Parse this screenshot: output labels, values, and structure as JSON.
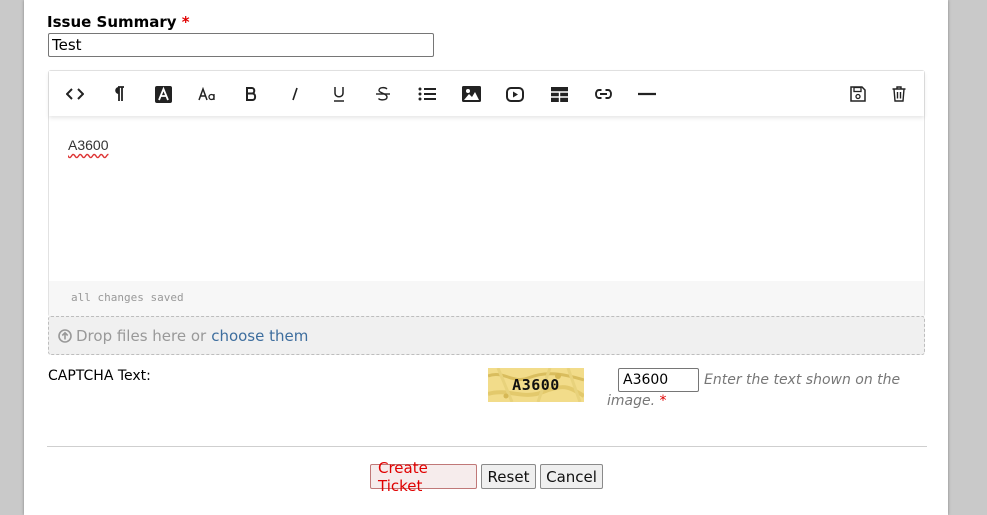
{
  "form": {
    "summary_label": "Issue Summary",
    "required_mark": "*",
    "summary_value": "Test"
  },
  "toolbar": {
    "buttons": [
      {
        "name": "source-code",
        "icon": "code-brackets-icon"
      },
      {
        "name": "paragraph",
        "icon": "pilcrow-icon"
      },
      {
        "name": "text-color",
        "icon": "text-color-icon"
      },
      {
        "name": "font-size",
        "icon": "font-size-icon"
      },
      {
        "name": "bold",
        "icon": "bold-icon"
      },
      {
        "name": "italic",
        "icon": "italic-icon"
      },
      {
        "name": "underline",
        "icon": "underline-icon"
      },
      {
        "name": "strikethrough",
        "icon": "strikethrough-icon"
      },
      {
        "name": "list",
        "icon": "list-icon"
      },
      {
        "name": "image",
        "icon": "image-icon"
      },
      {
        "name": "video",
        "icon": "video-icon"
      },
      {
        "name": "table",
        "icon": "table-icon"
      },
      {
        "name": "link",
        "icon": "link-icon"
      },
      {
        "name": "horizontal-rule",
        "icon": "horizontal-rule-icon"
      },
      {
        "name": "save-draft",
        "icon": "save-icon"
      },
      {
        "name": "delete-draft",
        "icon": "trash-icon"
      }
    ]
  },
  "editor": {
    "content": "A3600",
    "status": "all changes saved"
  },
  "dropzone": {
    "text": "Drop files here or",
    "link": "choose them"
  },
  "captcha": {
    "label": "CAPTCHA Text:",
    "image_text": "A3600",
    "input_value": "A3600",
    "hint_line1": "Enter the text shown on the",
    "hint_line2": "image.",
    "required_mark": "*"
  },
  "actions": {
    "create": "Create Ticket",
    "reset": "Reset",
    "cancel": "Cancel"
  },
  "colors": {
    "required": "#e00000",
    "link": "#3e6e9e",
    "captcha_bg": "#f2dc8a"
  }
}
